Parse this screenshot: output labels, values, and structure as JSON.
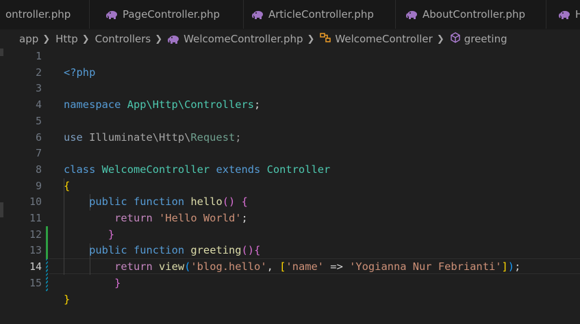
{
  "tabs": [
    {
      "label": "ontroller.php",
      "has_icon": false
    },
    {
      "label": "PageController.php",
      "icon": "php-elephant-icon"
    },
    {
      "label": "ArticleController.php",
      "icon": "php-elephant-icon"
    },
    {
      "label": "AboutController.php",
      "icon": "php-elephant-icon"
    },
    {
      "label": "H",
      "icon": "php-elephant-icon"
    }
  ],
  "breadcrumb": {
    "items": [
      "app",
      "Http",
      "Controllers",
      "WelcomeController.php",
      "WelcomeController",
      "greeting"
    ],
    "icons": {
      "file": "php-elephant-icon",
      "class": "class-icon",
      "method": "method-cube-icon"
    }
  },
  "editor": {
    "active_line": "14",
    "line_numbers": [
      "1",
      "2",
      "3",
      "4",
      "5",
      "6",
      "7",
      "8",
      "9",
      "10",
      "11",
      "12",
      "13",
      "14",
      "15"
    ],
    "lines": {
      "l1": {
        "open_tag": "<?php"
      },
      "l3": {
        "kw": "namespace",
        "ns": "App\\Http\\Controllers",
        "end": ";"
      },
      "l5": {
        "kw": "use",
        "ns": "Illuminate\\Http\\",
        "cls": "Request",
        "end": ";"
      },
      "l7": {
        "kw1": "class",
        "name": "WelcomeController",
        "kw2": "extends",
        "parent": "Controller"
      },
      "l8": {
        "brace": "{"
      },
      "l9": {
        "kw1": "public",
        "kw2": "function",
        "fn": "hello",
        "parens": "()",
        "brace": "{"
      },
      "l10": {
        "kw": "return",
        "str": "'Hello World'",
        "end": ";"
      },
      "l11": {
        "brace": "}"
      },
      "l12": {
        "kw1": "public",
        "kw2": "function",
        "fn": "greeting",
        "parens": "()",
        "brace": "{"
      },
      "l13": {
        "kw": "return",
        "fn": "view",
        "open": "(",
        "str1": "'blog.hello'",
        "comma": ", ",
        "arr_open": "[",
        "key": "'name'",
        "arrow": " => ",
        "val": "'Yogianna Nur Febrianti'",
        "arr_close": "]",
        "close": ")",
        "end": ";"
      },
      "l14": {
        "brace": "}"
      },
      "l15": {
        "brace": "}"
      }
    }
  },
  "colors": {
    "background": "#1f1f1f",
    "keyword": "#569cd6",
    "control": "#c586c0",
    "type": "#4ec9b0",
    "function": "#dcdcaa",
    "string": "#ce9178",
    "git_modified": "#2ea043"
  }
}
